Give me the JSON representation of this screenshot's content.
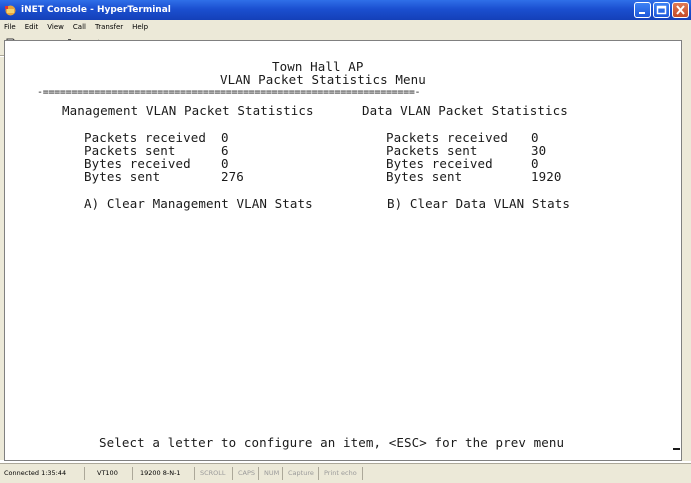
{
  "window": {
    "title": "iNET Console - HyperTerminal",
    "controls": [
      "minimize",
      "maximize",
      "close"
    ]
  },
  "menu": {
    "items": [
      "File",
      "Edit",
      "View",
      "Call",
      "Transfer",
      "Help"
    ]
  },
  "toolbar": {
    "icons": [
      "new-icon",
      "open-icon",
      "connect-icon",
      "disconnect-icon",
      "send-icon",
      "receive-icon",
      "properties-icon"
    ]
  },
  "terminal": {
    "header_title": "Town Hall AP",
    "menu_title": "VLAN Packet Statistics Menu",
    "divider": "-=================================================================-",
    "management": {
      "heading": "Management VLAN Packet Statistics",
      "rows": [
        {
          "label": "Packets received",
          "value": "0"
        },
        {
          "label": "Packets sent",
          "value": "6"
        },
        {
          "label": "Bytes received",
          "value": "0"
        },
        {
          "label": "Bytes sent",
          "value": "276"
        }
      ],
      "option": "A) Clear Management VLAN Stats"
    },
    "data": {
      "heading": "Data VLAN Packet Statistics",
      "rows": [
        {
          "label": "Packets received",
          "value": "0"
        },
        {
          "label": "Packets sent",
          "value": "30"
        },
        {
          "label": "Bytes received",
          "value": "0"
        },
        {
          "label": "Bytes sent",
          "value": "1920"
        }
      ],
      "option": "B) Clear Data VLAN Stats"
    },
    "prompt": "Select a letter to configure an item, <ESC> for the prev menu"
  },
  "status": {
    "connected": "Connected 1:35:44",
    "emulation": "VT100",
    "settings": "19200 8-N-1",
    "scroll": "SCROLL",
    "caps": "CAPS",
    "num": "NUM",
    "capture": "Capture",
    "print_echo": "Print echo"
  }
}
